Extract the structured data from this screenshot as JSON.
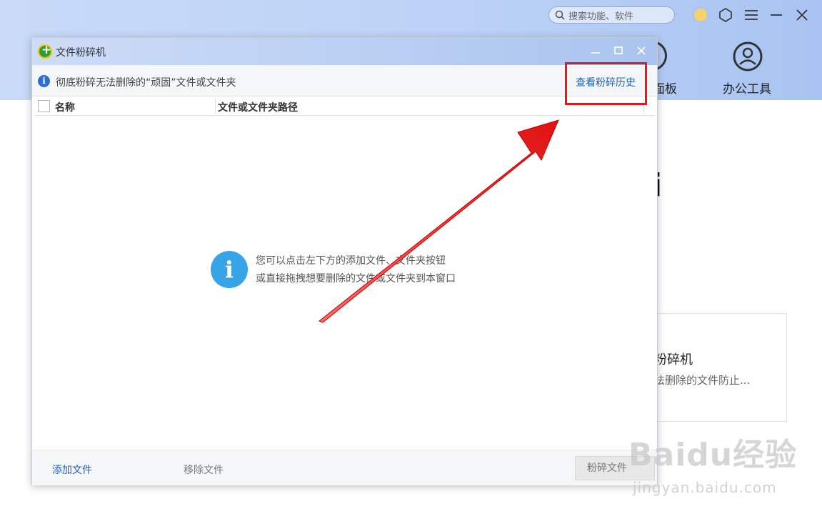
{
  "background_app": {
    "search_placeholder": "搜索功能、软件",
    "tab_partial_label": "面板",
    "tab_office_label": "办公工具",
    "partial_heading": "i",
    "card_title": "粉碎机",
    "card_desc": "法删除的文件防止..."
  },
  "dialog": {
    "title": "文件粉碎机",
    "notice_text": "彻底粉碎无法删除的“顽固”文件或文件夹",
    "history_link": "查看粉碎历史",
    "columns": [
      "名称",
      "文件或文件夹路径"
    ],
    "empty_line1": "您可以点击左下方的添加文件、文件夹按钮",
    "empty_line2": "或直接拖拽想要删除的文件或文件夹到本窗口",
    "footer": {
      "add_file": "添加文件",
      "remove_file": "移除文件",
      "shred": "粉碎文件"
    }
  },
  "watermark": {
    "main": "Baidu经验",
    "sub": "jingyan.baidu.com"
  },
  "colors": {
    "accent_blue": "#1f5fbf",
    "highlight_red": "#e01b1b",
    "info_blue": "#38a4e8"
  }
}
